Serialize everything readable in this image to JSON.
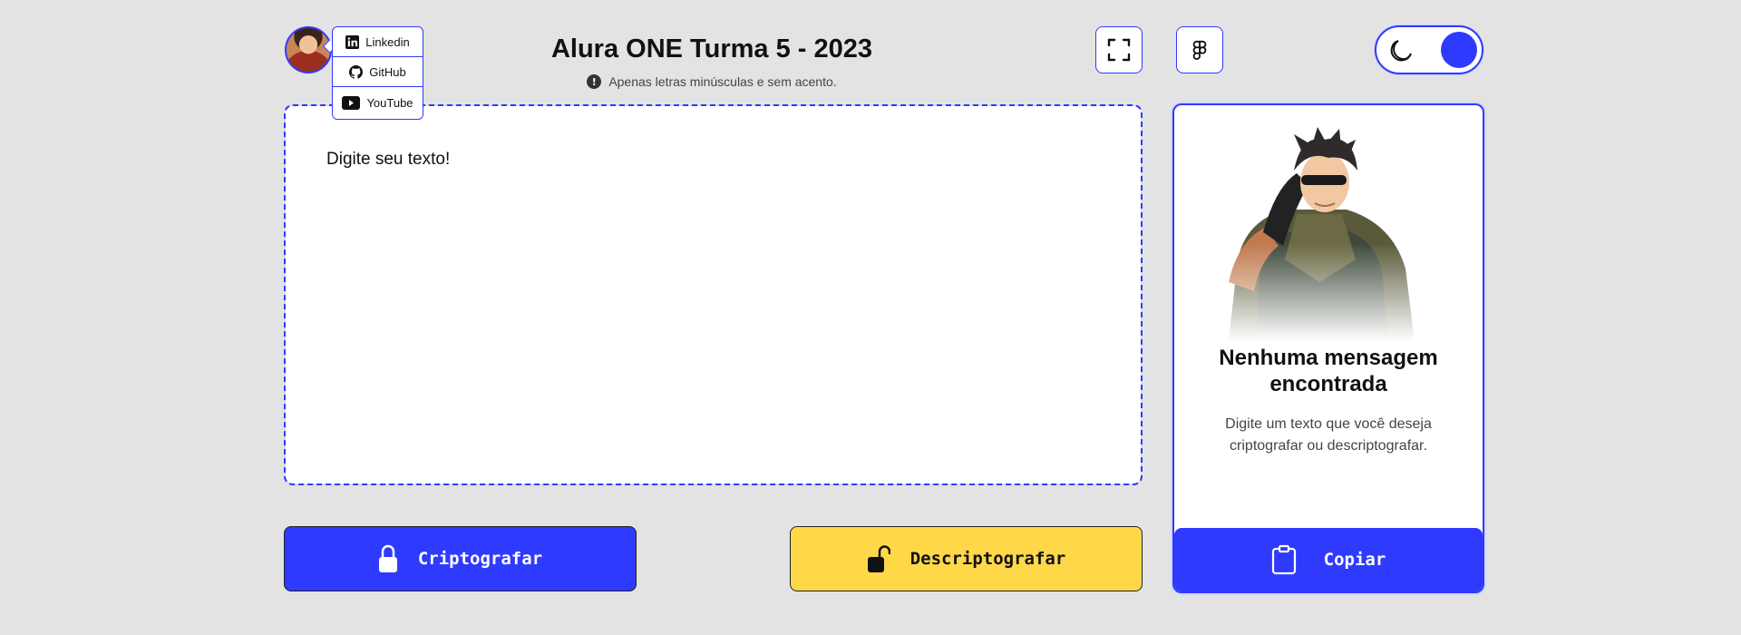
{
  "header": {
    "title": "Alura ONE Turma 5 - 2023",
    "hint": "Apenas letras minúsculas e sem acento.",
    "hint_icon": "info-icon"
  },
  "social": {
    "items": [
      {
        "label": "Linkedin",
        "icon": "linkedin-icon"
      },
      {
        "label": "GitHub",
        "icon": "github-icon"
      },
      {
        "label": "YouTube",
        "icon": "youtube-icon"
      }
    ]
  },
  "toolbar": {
    "fullscreen_icon": "fullscreen-icon",
    "figma_icon": "figma-icon",
    "theme_icon": "moon-icon"
  },
  "editor": {
    "placeholder": "Digite seu texto!",
    "value": ""
  },
  "actions": {
    "encrypt_label": "Criptografar",
    "decrypt_label": "Descriptografar"
  },
  "output": {
    "empty_title": "Nenhuma mensagem encontrada",
    "empty_text": "Digite um texto que você deseja criptografar ou descriptografar.",
    "copy_label": "Copiar"
  },
  "colors": {
    "accent": "#2f3aff",
    "secondary": "#ffd84a",
    "background": "#e3e3e3"
  }
}
